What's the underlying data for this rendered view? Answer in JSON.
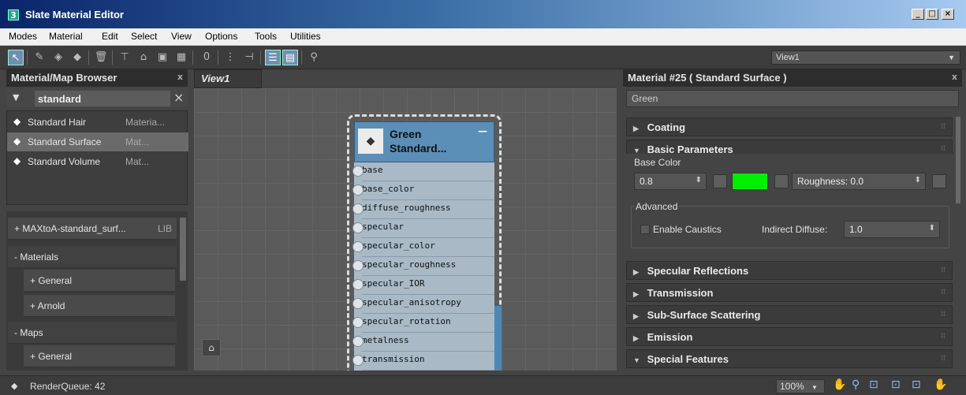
{
  "window": {
    "title": "Slate Material Editor",
    "app_icon": "3",
    "min": "_",
    "max": "□",
    "close": "×"
  },
  "menu": [
    "Modes",
    "Material",
    "Edit",
    "Select",
    "View",
    "Options",
    "Tools",
    "Utilities"
  ],
  "toolbar": {
    "view_select": "View1",
    "icons": [
      "pointer-icon",
      "eyedropper-icon",
      "put-to-scene-icon",
      "assign-to-selection-icon",
      "delete-icon",
      "move-children-icon",
      "hide-unused-icon",
      "background-icon",
      "checker-icon",
      "material-id-icon",
      "show-map-icon",
      "lay-out-all-icon",
      "layout-children-icon",
      "material-map-browser-icon",
      "parameter-editor-icon",
      "select-by-material-icon"
    ]
  },
  "browser": {
    "title": "Material/Map Browser",
    "close": "x",
    "search_value": "standard",
    "clear": "×",
    "results": [
      {
        "name": "Standard Hair",
        "type": "Materia..."
      },
      {
        "name": "Standard Surface",
        "type": "Mat..."
      },
      {
        "name": "Standard Volume",
        "type": "Mat..."
      }
    ],
    "libraries": [
      {
        "label": "+ MAXtoA-standard_surf...",
        "tag": "LIB"
      },
      {
        "label": "- Materials"
      },
      {
        "label": "+ General"
      },
      {
        "label": "+ Arnold"
      },
      {
        "label": "- Maps"
      },
      {
        "label": "+ General"
      }
    ]
  },
  "view": {
    "tab": "View1",
    "node": {
      "title_line1": "Green",
      "title_line2": "Standard...",
      "min": "—",
      "slots": [
        "base",
        "base_color",
        "diffuse_roughness",
        "specular",
        "specular_color",
        "specular_roughness",
        "specular_IOR",
        "specular_anisotropy",
        "specular_rotation",
        "metalness",
        "transmission"
      ]
    }
  },
  "params": {
    "title": "Material #25  ( Standard Surface )",
    "close": "x",
    "material_name": "Green",
    "rollouts": {
      "coating": "Coating",
      "basic": "Basic Parameters",
      "specular": "Specular Reflections",
      "transmission": "Transmission",
      "sss": "Sub-Surface Scattering",
      "emission": "Emission",
      "special": "Special Features"
    },
    "base_color_label": "Base Color",
    "base_weight": "0.8",
    "swatch_color": "#00ee00",
    "roughness_label": "Roughness:",
    "roughness_value": "0.0",
    "advanced_label": "Advanced",
    "enable_caustics": "Enable Caustics",
    "indirect_diffuse_label": "Indirect Diffuse:",
    "indirect_diffuse_value": "1.0"
  },
  "status": {
    "render_queue": "RenderQueue: 42",
    "zoom": "100%"
  }
}
